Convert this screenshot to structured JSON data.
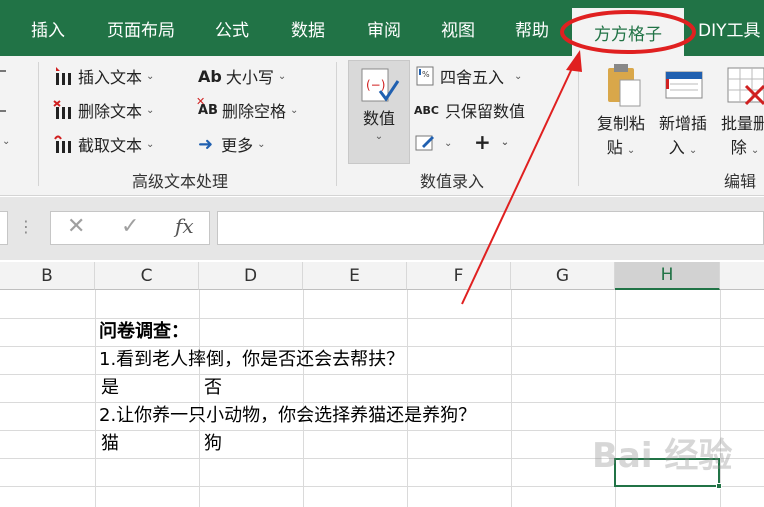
{
  "ribbon_tabs": [
    {
      "label": "插入"
    },
    {
      "label": "页面布局"
    },
    {
      "label": "公式"
    },
    {
      "label": "数据"
    },
    {
      "label": "审阅"
    },
    {
      "label": "视图"
    },
    {
      "label": "帮助"
    },
    {
      "label": "方方格子",
      "active": true
    },
    {
      "label": "DIY工具"
    }
  ],
  "text_group": {
    "insert_text": "插入文本",
    "delete_text": "删除文本",
    "extract_text": "截取文本",
    "case": "大小写",
    "case_icon_text": "Ab",
    "delete_spaces": "删除空格",
    "delete_spaces_icon_text": "AB",
    "more": "更多",
    "label": "高级文本处理"
  },
  "numeric_group": {
    "value_button": "数值",
    "round": "四舍五入",
    "keep_value": "只保留数值",
    "keep_value_icon_text": "ABC",
    "plus": "+",
    "label": "数值录入"
  },
  "edit_group": {
    "copy_paste_line1": "复制粘",
    "copy_paste_line2": "贴",
    "insert_new_line1": "新增插",
    "insert_new_line2": "入",
    "batch_delete_line1": "批量删",
    "batch_delete_line2": "除",
    "label": "编辑"
  },
  "formula_bar": {
    "cancel_icon": "✕",
    "enter_icon": "✓",
    "fx_icon": "fx",
    "dots": "⋮",
    "value": ""
  },
  "columns": [
    "B",
    "C",
    "D",
    "E",
    "F",
    "G",
    "H"
  ],
  "selected_column": "H",
  "cells": {
    "r1c": "问卷调查：",
    "r2c": "1.看到老人摔倒，你是否还会去帮扶？",
    "r3c": "是",
    "r3d": "否",
    "r4c": "2.让你养一只小动物，你会选择养猫还是养狗？",
    "r5c": "猫",
    "r5d": "狗"
  },
  "watermark": "Bai 经验",
  "colors": {
    "excel_green": "#217346",
    "annotation_red": "#e02020"
  }
}
